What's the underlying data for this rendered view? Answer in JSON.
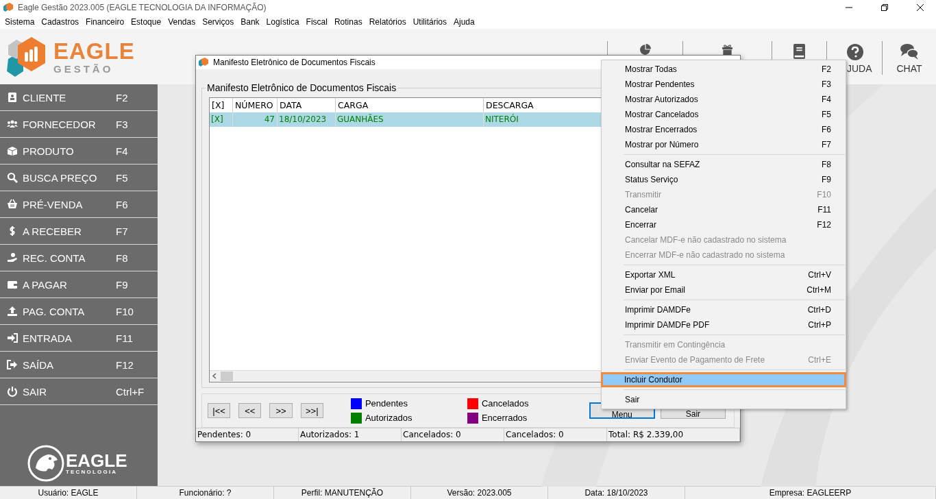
{
  "window": {
    "title": "Eagle Gestão 2023.005 (EAGLE TECNOLOGIA DA INFORMAÇÃO)"
  },
  "menu_bar": [
    "Sistema",
    "Cadastros",
    "Financeiro",
    "Estoque",
    "Vendas",
    "Serviços",
    "Bank",
    "Logística",
    "Fiscal",
    "Rotinas",
    "Relatórios",
    "Utilitários",
    "Ajuda"
  ],
  "logo": {
    "name": "EAGLE",
    "subtitle": "GESTÃO"
  },
  "toolbar": [
    {
      "kind": "icon"
    },
    {
      "kind": "icon"
    },
    {
      "kind": "icon"
    },
    {
      "kind": "labeled",
      "label": "JUDA"
    },
    {
      "kind": "labeled",
      "label": "CHAT"
    }
  ],
  "sidebar": {
    "items": [
      {
        "label": "CLIENTE",
        "shortcut": "F2"
      },
      {
        "label": "FORNECEDOR",
        "shortcut": "F3"
      },
      {
        "label": "PRODUTO",
        "shortcut": "F4"
      },
      {
        "label": "BUSCA PREÇO",
        "shortcut": "F5"
      },
      {
        "label": "PRÉ-VENDA",
        "shortcut": "F6"
      },
      {
        "label": "A RECEBER",
        "shortcut": "F7"
      },
      {
        "label": "REC. CONTA",
        "shortcut": "F8"
      },
      {
        "label": "A PAGAR",
        "shortcut": "F9"
      },
      {
        "label": "PAG. CONTA",
        "shortcut": "F10"
      },
      {
        "label": "ENTRADA",
        "shortcut": "F11"
      },
      {
        "label": "SAÍDA",
        "shortcut": "F12"
      },
      {
        "label": "SAIR",
        "shortcut": "Ctrl+F"
      }
    ],
    "footer_logo": {
      "name": "EAGLE",
      "subtitle": "TECNOLOGIA"
    }
  },
  "dialog": {
    "title": "Manifesto Eletrônico de Documentos Fiscais",
    "group_title": "Manifesto Eletrônico de Documentos Fiscais",
    "table": {
      "columns": [
        "[X]",
        "NÚMERO",
        "DATA",
        "CARGA",
        "DESCARGA"
      ],
      "rows": [
        {
          "selected": true,
          "color": "#008000",
          "cells": [
            "[X]",
            "47",
            "18/10/2023",
            "GUANHÃES",
            "NITERÓI"
          ]
        }
      ]
    },
    "nav_buttons": [
      "|<<",
      "<<",
      ">>",
      ">>|"
    ],
    "legend": [
      {
        "label": "Pendentes",
        "color": "#0000ff"
      },
      {
        "label": "Autorizados",
        "color": "#008000"
      },
      {
        "label": "Cancelados",
        "color": "#ff0000"
      },
      {
        "label": "Encerrados",
        "color": "#800080"
      }
    ],
    "buttons": [
      {
        "label": "Menu",
        "focused": true
      },
      {
        "label": "Sair"
      }
    ],
    "status_bar": [
      "Pendentes: 0",
      "Autorizados: 1",
      "Cancelados: 0",
      "Cancelados: 0",
      "Total: R$ 2.339,00"
    ]
  },
  "context_menu": {
    "items": [
      {
        "kind": "item",
        "label": "Mostrar Todas",
        "shortcut": "F2",
        "disabled": false,
        "selected": false
      },
      {
        "kind": "item",
        "label": "Mostrar Pendentes",
        "shortcut": "F3",
        "disabled": false,
        "selected": false
      },
      {
        "kind": "item",
        "label": "Mostrar Autorizados",
        "shortcut": "F4",
        "disabled": false,
        "selected": false
      },
      {
        "kind": "item",
        "label": "Mostrar Cancelados",
        "shortcut": "F5",
        "disabled": false,
        "selected": false
      },
      {
        "kind": "item",
        "label": "Mostrar Encerrados",
        "shortcut": "F6",
        "disabled": false,
        "selected": false
      },
      {
        "kind": "item",
        "label": "Mostrar por Número",
        "shortcut": "F7",
        "disabled": false,
        "selected": false
      },
      {
        "kind": "separator"
      },
      {
        "kind": "item",
        "label": "Consultar na SEFAZ",
        "shortcut": "F8",
        "disabled": false,
        "selected": false
      },
      {
        "kind": "item",
        "label": "Status Serviço",
        "shortcut": "F9",
        "disabled": false,
        "selected": false
      },
      {
        "kind": "item",
        "label": "Transmitir",
        "shortcut": "F10",
        "disabled": true,
        "selected": false
      },
      {
        "kind": "item",
        "label": "Cancelar",
        "shortcut": "F11",
        "disabled": false,
        "selected": false
      },
      {
        "kind": "item",
        "label": "Encerrar",
        "shortcut": "F12",
        "disabled": false,
        "selected": false
      },
      {
        "kind": "item",
        "label": "Cancelar MDF-e não cadastrado no sistema",
        "disabled": true,
        "selected": false
      },
      {
        "kind": "item",
        "label": "Encerrar MDF-e não cadastrado no sistema",
        "disabled": true,
        "selected": false
      },
      {
        "kind": "separator"
      },
      {
        "kind": "item",
        "label": "Exportar XML",
        "shortcut": "Ctrl+V",
        "disabled": false,
        "selected": false
      },
      {
        "kind": "item",
        "label": "Enviar por Email",
        "shortcut": "Ctrl+M",
        "disabled": false,
        "selected": false
      },
      {
        "kind": "separator"
      },
      {
        "kind": "item",
        "label": "Imprimir DAMDFe",
        "shortcut": "Ctrl+D",
        "disabled": false,
        "selected": false
      },
      {
        "kind": "item",
        "label": "Imprimir DAMDFe PDF",
        "shortcut": "Ctrl+P",
        "disabled": false,
        "selected": false
      },
      {
        "kind": "separator"
      },
      {
        "kind": "item",
        "label": "Transmitir em Contingência",
        "disabled": true,
        "selected": false
      },
      {
        "kind": "item",
        "label": "Enviar Evento de Pagamento de Frete",
        "shortcut": "Ctrl+E",
        "disabled": true,
        "selected": false
      },
      {
        "kind": "separator"
      },
      {
        "kind": "item",
        "label": "Incluir Condutor",
        "disabled": false,
        "selected": true
      },
      {
        "kind": "separator"
      },
      {
        "kind": "item",
        "label": "Sair",
        "disabled": false,
        "selected": false
      }
    ]
  },
  "status_bar": [
    "Usuário: EAGLE",
    "Funcionário: ?",
    "Perfil: MANUTENÇÃO",
    "Versão: 2023.005",
    "Data: 18/10/2023",
    "Empresa: EAGLEERP"
  ]
}
